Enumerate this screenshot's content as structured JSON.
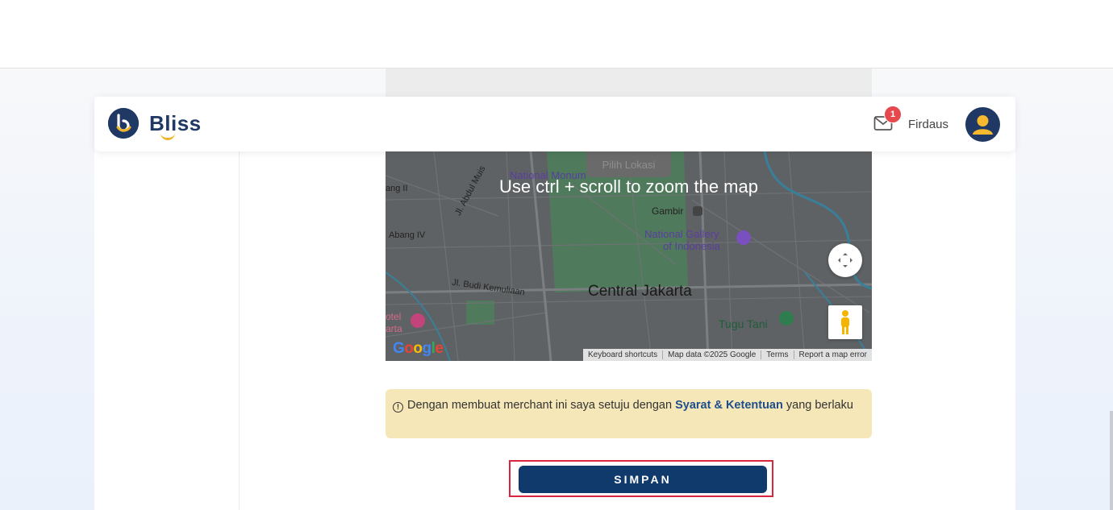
{
  "app": {
    "brand": "Bliss"
  },
  "header": {
    "notification_count": "1",
    "username": "Firdaus"
  },
  "map": {
    "overlay_text": "Use ctrl + scroll to zoom the map",
    "pick_location": "Pilih Lokasi",
    "labels": {
      "national_monument": "National Monum",
      "gambir": "Gambir",
      "national_gallery_1": "National Gallery",
      "national_gallery_2": "of Indonesia",
      "jl_abdul_muis": "Jl. Abdul Muis",
      "jl_budi": "Jl. Budi Kemuliaan",
      "central": "Central Jakarta",
      "tugu_tani": "Tugu Tani",
      "abang_ii": "ang II",
      "abang_iv": "Abang IV",
      "hotel_1": "otel",
      "hotel_2": "arta"
    },
    "google": "Google",
    "attribution": [
      "Keyboard shortcuts",
      "Map data ©2025 Google",
      "Terms",
      "Report a map error"
    ]
  },
  "notice": {
    "text_before": "Dengan membuat merchant ini saya setuju dengan",
    "link": "Syarat & Ketentuan",
    "text_after": "yang berlaku"
  },
  "actions": {
    "save_label": "SIMPAN"
  },
  "colors": {
    "primary": "#0f3a6b",
    "brand_navy": "#1f3864",
    "notice_bg": "#f6e7b8",
    "badge": "#e5484d",
    "highlight": "#d7263d"
  }
}
